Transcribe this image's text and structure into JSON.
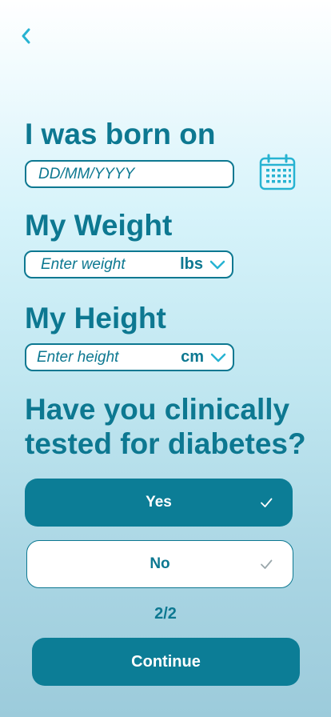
{
  "nav": {
    "back_icon": "chevron-left-icon"
  },
  "birth": {
    "heading": "I was born on",
    "placeholder": "DD/MM/YYYY",
    "calendar_icon": "calendar-icon"
  },
  "weight": {
    "heading": "My Weight",
    "placeholder": "Enter weight",
    "unit": "lbs",
    "unit_icon": "chevron-down-icon"
  },
  "height": {
    "heading": "My Height",
    "placeholder": "Enter height",
    "unit": "cm",
    "unit_icon": "chevron-down-icon"
  },
  "question": {
    "text": "Have you clinically tested for diabetes?",
    "options": [
      {
        "label": "Yes",
        "selected": true,
        "icon": "check-icon"
      },
      {
        "label": "No",
        "selected": false,
        "icon": "check-icon"
      }
    ]
  },
  "progress": {
    "text": "2/2"
  },
  "continue_label": "Continue",
  "colors": {
    "primary": "#0c7d96",
    "text": "#0d7891",
    "surface": "#ffffff"
  }
}
